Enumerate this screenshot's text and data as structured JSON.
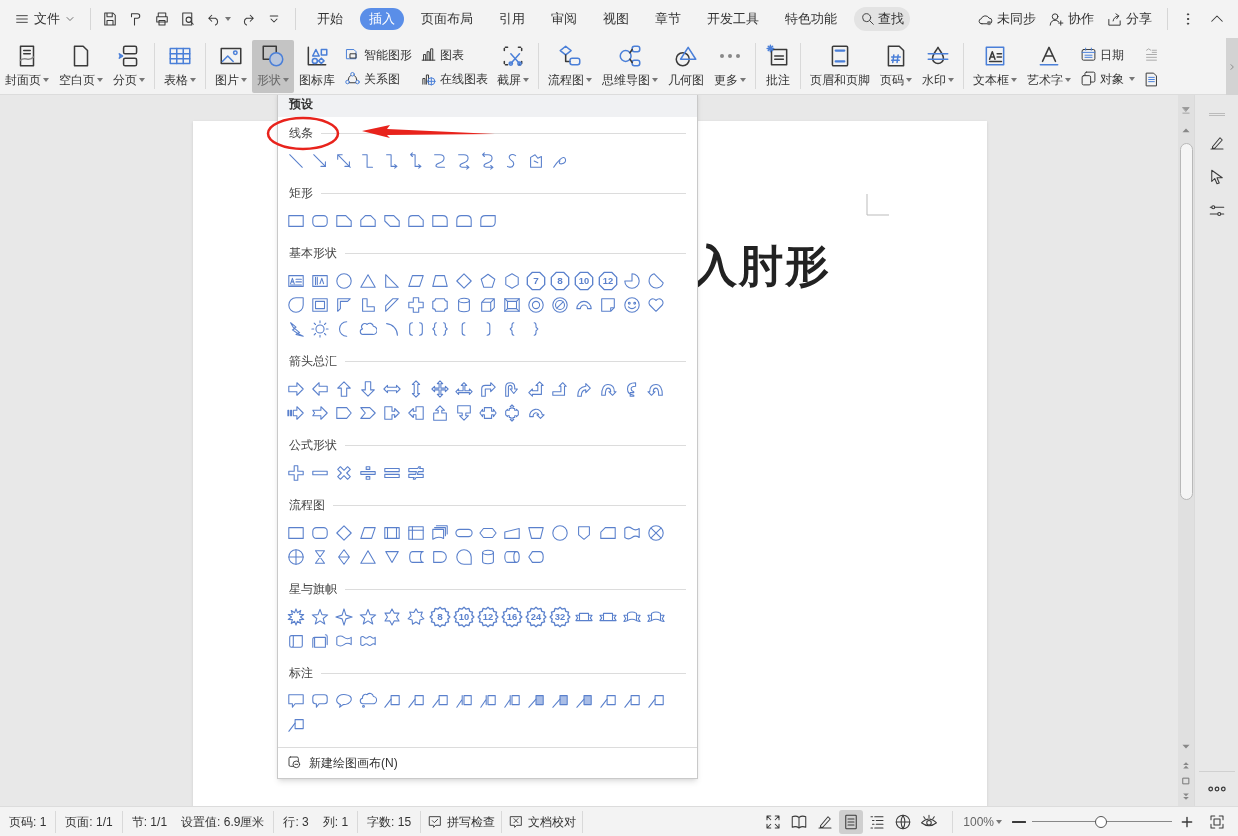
{
  "menu": {
    "label": "文件"
  },
  "tabs": [
    {
      "label": "开始",
      "selected": false
    },
    {
      "label": "插入",
      "selected": true
    },
    {
      "label": "页面布局",
      "selected": false
    },
    {
      "label": "引用",
      "selected": false
    },
    {
      "label": "审阅",
      "selected": false
    },
    {
      "label": "视图",
      "selected": false
    },
    {
      "label": "章节",
      "selected": false
    },
    {
      "label": "开发工具",
      "selected": false
    },
    {
      "label": "特色功能",
      "selected": false
    }
  ],
  "search": {
    "label": "查找"
  },
  "top_actions": [
    {
      "label": "未同步"
    },
    {
      "label": "协作"
    },
    {
      "label": "分享"
    }
  ],
  "ribbon": {
    "groups": [
      [
        {
          "kind": "large",
          "label": "封面页",
          "dropdown": true,
          "selected": false
        },
        {
          "kind": "large",
          "label": "空白页",
          "dropdown": true,
          "selected": false
        },
        {
          "kind": "large",
          "label": "分页",
          "dropdown": true,
          "selected": false
        }
      ],
      [
        {
          "kind": "large",
          "label": "表格",
          "dropdown": true,
          "selected": false
        }
      ],
      [
        {
          "kind": "large",
          "label": "图片",
          "dropdown": true,
          "selected": false
        },
        {
          "kind": "large",
          "label": "形状",
          "dropdown": true,
          "selected": true
        },
        {
          "kind": "large",
          "label": "图标库",
          "dropdown": false,
          "selected": false
        },
        {
          "kind": "stack",
          "items": [
            {
              "label": "智能图形",
              "dropdown": false
            },
            {
              "label": "关系图",
              "dropdown": false
            }
          ]
        },
        {
          "kind": "stack",
          "items": [
            {
              "label": "图表",
              "dropdown": false
            },
            {
              "label": "在线图表",
              "dropdown": false
            }
          ]
        },
        {
          "kind": "large",
          "label": "截屏",
          "dropdown": true,
          "selected": false
        }
      ],
      [
        {
          "kind": "large",
          "label": "流程图",
          "dropdown": true,
          "selected": false
        },
        {
          "kind": "large",
          "label": "思维导图",
          "dropdown": true,
          "selected": false
        },
        {
          "kind": "large",
          "label": "几何图",
          "dropdown": false,
          "selected": false
        },
        {
          "kind": "large",
          "label": "更多",
          "dropdown": true,
          "selected": false
        }
      ],
      [
        {
          "kind": "large",
          "label": "批注",
          "dropdown": false,
          "selected": false
        }
      ],
      [
        {
          "kind": "large",
          "label": "页眉和页脚",
          "dropdown": false,
          "selected": false
        },
        {
          "kind": "large",
          "label": "页码",
          "dropdown": true,
          "selected": false
        },
        {
          "kind": "large",
          "label": "水印",
          "dropdown": true,
          "selected": false
        }
      ],
      [
        {
          "kind": "large",
          "label": "文本框",
          "dropdown": true,
          "selected": false
        },
        {
          "kind": "large",
          "label": "艺术字",
          "dropdown": true,
          "selected": false
        },
        {
          "kind": "stack",
          "items": [
            {
              "label": "日期",
              "dropdown": false
            },
            {
              "label": "对象",
              "dropdown": true
            }
          ]
        },
        {
          "kind": "icon-stack"
        }
      ]
    ]
  },
  "shapes_menu": {
    "header": "预设",
    "sections": [
      {
        "title": "线条",
        "shapes": [
          {
            "kind": "line"
          },
          {
            "kind": "arrow-line"
          },
          {
            "kind": "double-arrow-line"
          },
          {
            "kind": "elbow"
          },
          {
            "kind": "elbow-arrow"
          },
          {
            "kind": "elbow-double-arrow"
          },
          {
            "kind": "curve"
          },
          {
            "kind": "curve-arrow"
          },
          {
            "kind": "curve-double-arrow"
          },
          {
            "kind": "s-curve"
          },
          {
            "kind": "freeform"
          },
          {
            "kind": "scribble"
          }
        ]
      },
      {
        "title": "矩形",
        "shapes": [
          {
            "kind": "rect"
          },
          {
            "kind": "round-rect"
          },
          {
            "kind": "snip-rect"
          },
          {
            "kind": "snip2-rect"
          },
          {
            "kind": "snip-diag-rect"
          },
          {
            "kind": "snip-round-rect"
          },
          {
            "kind": "round1-rect"
          },
          {
            "kind": "round2-rect"
          },
          {
            "kind": "round-diag-rect"
          }
        ]
      },
      {
        "title": "基本形状",
        "shapes": [
          {
            "kind": "textbox"
          },
          {
            "kind": "vertical-textbox"
          },
          {
            "kind": "oval"
          },
          {
            "kind": "triangle"
          },
          {
            "kind": "right-triangle"
          },
          {
            "kind": "parallelogram"
          },
          {
            "kind": "trapezoid"
          },
          {
            "kind": "diamond"
          },
          {
            "kind": "pentagon"
          },
          {
            "kind": "hexagon"
          },
          {
            "kind": "numbered-polygon",
            "label": "7"
          },
          {
            "kind": "numbered-polygon",
            "label": "8"
          },
          {
            "kind": "numbered-polygon",
            "label": "10"
          },
          {
            "kind": "numbered-polygon",
            "label": "12"
          },
          {
            "kind": "pie"
          },
          {
            "kind": "chord"
          },
          {
            "kind": "teardrop"
          },
          {
            "kind": "frame"
          },
          {
            "kind": "half-frame"
          },
          {
            "kind": "l-shape"
          },
          {
            "kind": "diagonal-stripe"
          },
          {
            "kind": "cross"
          },
          {
            "kind": "plaque"
          },
          {
            "kind": "can"
          },
          {
            "kind": "cube"
          },
          {
            "kind": "bevel"
          },
          {
            "kind": "donut"
          },
          {
            "kind": "no-symbol"
          },
          {
            "kind": "block-arc"
          },
          {
            "kind": "folded-corner"
          },
          {
            "kind": "smiley"
          },
          {
            "kind": "heart"
          },
          {
            "kind": "lightning"
          },
          {
            "kind": "sun"
          },
          {
            "kind": "moon"
          },
          {
            "kind": "cloud"
          },
          {
            "kind": "arc"
          },
          {
            "kind": "bracket-pair"
          },
          {
            "kind": "brace-pair"
          },
          {
            "kind": "left-bracket"
          },
          {
            "kind": "right-bracket"
          },
          {
            "kind": "left-brace"
          },
          {
            "kind": "right-brace"
          }
        ]
      },
      {
        "title": "箭头总汇",
        "shapes": [
          {
            "kind": "arrow-right"
          },
          {
            "kind": "arrow-left"
          },
          {
            "kind": "arrow-up"
          },
          {
            "kind": "arrow-down"
          },
          {
            "kind": "arrow-left-right"
          },
          {
            "kind": "arrow-up-down"
          },
          {
            "kind": "arrow-quad"
          },
          {
            "kind": "arrow-three-way"
          },
          {
            "kind": "arrow-bent"
          },
          {
            "kind": "arrow-u-turn"
          },
          {
            "kind": "arrow-left-up"
          },
          {
            "kind": "arrow-bent-up"
          },
          {
            "kind": "arrow-curved-right"
          },
          {
            "kind": "arrow-curved-up"
          },
          {
            "kind": "arrow-curved-left"
          },
          {
            "kind": "arrow-curved-down"
          },
          {
            "kind": "arrow-striped"
          },
          {
            "kind": "arrow-notched"
          },
          {
            "kind": "home-plate"
          },
          {
            "kind": "chevron"
          },
          {
            "kind": "arrow-callout-right"
          },
          {
            "kind": "arrow-callout-left"
          },
          {
            "kind": "arrow-callout-up"
          },
          {
            "kind": "arrow-callout-down"
          },
          {
            "kind": "arrow-callout-left-right"
          },
          {
            "kind": "arrow-callout-quad"
          },
          {
            "kind": "arrow-circular"
          }
        ]
      },
      {
        "title": "公式形状",
        "shapes": [
          {
            "kind": "plus"
          },
          {
            "kind": "minus"
          },
          {
            "kind": "multiply"
          },
          {
            "kind": "divide"
          },
          {
            "kind": "equal"
          },
          {
            "kind": "not-equal"
          }
        ]
      },
      {
        "title": "流程图",
        "shapes": [
          {
            "kind": "rect"
          },
          {
            "kind": "round-rect"
          },
          {
            "kind": "diamond"
          },
          {
            "kind": "parallelogram"
          },
          {
            "kind": "predefined-process"
          },
          {
            "kind": "internal-storage"
          },
          {
            "kind": "multi-document"
          },
          {
            "kind": "terminator"
          },
          {
            "kind": "preparation"
          },
          {
            "kind": "manual-input"
          },
          {
            "kind": "manual-operation"
          },
          {
            "kind": "oval"
          },
          {
            "kind": "off-page"
          },
          {
            "kind": "card"
          },
          {
            "kind": "punched-tape"
          },
          {
            "kind": "summing-junction"
          },
          {
            "kind": "or"
          },
          {
            "kind": "collate"
          },
          {
            "kind": "sort"
          },
          {
            "kind": "triangle"
          },
          {
            "kind": "merge"
          },
          {
            "kind": "stored-data"
          },
          {
            "kind": "delay"
          },
          {
            "kind": "sequential-data"
          },
          {
            "kind": "can"
          },
          {
            "kind": "direct-access"
          },
          {
            "kind": "display"
          }
        ]
      },
      {
        "title": "星与旗帜",
        "shapes": [
          {
            "kind": "explosion"
          },
          {
            "kind": "star5"
          },
          {
            "kind": "star4"
          },
          {
            "kind": "star5"
          },
          {
            "kind": "star6"
          },
          {
            "kind": "star7"
          },
          {
            "kind": "numbered-star",
            "label": "8"
          },
          {
            "kind": "numbered-star",
            "label": "10"
          },
          {
            "kind": "numbered-star",
            "label": "12"
          },
          {
            "kind": "numbered-star",
            "label": "16"
          },
          {
            "kind": "numbered-star",
            "label": "24"
          },
          {
            "kind": "numbered-star",
            "label": "32"
          },
          {
            "kind": "ribbon"
          },
          {
            "kind": "ribbon"
          },
          {
            "kind": "curved-ribbon"
          },
          {
            "kind": "curved-ribbon"
          },
          {
            "kind": "vertical-scroll"
          },
          {
            "kind": "horizontal-scroll"
          },
          {
            "kind": "wave"
          },
          {
            "kind": "double-wave"
          }
        ]
      },
      {
        "title": "标注",
        "shapes": [
          {
            "kind": "rect-callout"
          },
          {
            "kind": "round-rect-callout"
          },
          {
            "kind": "oval-callout"
          },
          {
            "kind": "cloud-callout"
          },
          {
            "kind": "line-callout"
          },
          {
            "kind": "line-callout"
          },
          {
            "kind": "line-callout"
          },
          {
            "kind": "accent-callout"
          },
          {
            "kind": "accent-callout"
          },
          {
            "kind": "accent-callout"
          },
          {
            "kind": "filled-callout"
          },
          {
            "kind": "filled-callout"
          },
          {
            "kind": "filled-callout"
          },
          {
            "kind": "line-callout"
          },
          {
            "kind": "line-callout"
          },
          {
            "kind": "line-callout"
          },
          {
            "kind": "line-callout"
          }
        ]
      }
    ],
    "footer": "新建绘图画布(N)"
  },
  "document": {
    "heading": "入肘形"
  },
  "status_bar": {
    "cells": [
      {
        "texts": [
          "页码: 1"
        ]
      },
      {
        "texts": [
          "页面: 1/1"
        ]
      },
      {
        "texts": [
          "节: 1/1",
          "设置值: 6.9厘米"
        ]
      },
      {
        "texts": [
          "行: 3",
          "列: 1"
        ]
      },
      {
        "texts": [
          "字数: 15"
        ]
      }
    ],
    "buttons": [
      {
        "label": "拼写检查"
      },
      {
        "label": "文档校对"
      }
    ],
    "view_modes": [
      {
        "selected": false
      },
      {
        "selected": false
      },
      {
        "selected": false
      },
      {
        "selected": true
      },
      {
        "selected": false
      },
      {
        "selected": false
      },
      {
        "selected": false
      }
    ],
    "zoom": {
      "value": "100%",
      "level": 0.49
    }
  }
}
